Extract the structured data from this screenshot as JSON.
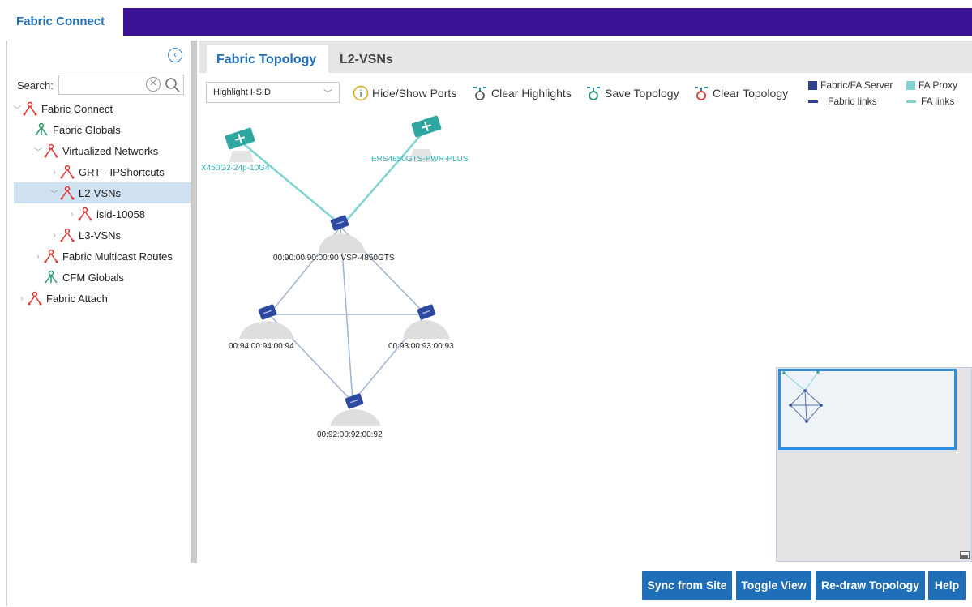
{
  "app": {
    "tab_title": "Fabric Connect"
  },
  "sidebar": {
    "search_label": "Search:",
    "search_placeholder": "",
    "tree": [
      {
        "label": "Fabric Connect",
        "icon": "network-red-icon",
        "expanded": true
      },
      {
        "label": "Fabric Globals",
        "icon": "network-green-icon"
      },
      {
        "label": "Virtualized Networks",
        "icon": "network-red-icon",
        "expanded": true
      },
      {
        "label": "GRT - IPShortcuts",
        "icon": "network-red-icon"
      },
      {
        "label": "L2-VSNs",
        "icon": "network-red-icon",
        "expanded": true,
        "selected": true
      },
      {
        "label": "isid-10058",
        "icon": "network-red-icon"
      },
      {
        "label": "L3-VSNs",
        "icon": "network-red-icon"
      },
      {
        "label": "Fabric Multicast Routes",
        "icon": "network-red-icon"
      },
      {
        "label": "CFM Globals",
        "icon": "network-green-icon"
      },
      {
        "label": "Fabric Attach",
        "icon": "network-red-icon"
      }
    ]
  },
  "tabs": [
    {
      "label": "Fabric Topology",
      "active": true
    },
    {
      "label": "L2-VSNs",
      "active": false
    }
  ],
  "toolbar": {
    "highlight_select": "Highlight I-SID",
    "hide_show_ports": "Hide/Show Ports",
    "clear_highlights": "Clear Highlights",
    "save_topology": "Save Topology",
    "clear_topology": "Clear Topology"
  },
  "legend": {
    "fabric_server": "Fabric/FA Server",
    "fa_proxy": "FA Proxy",
    "fabric_links": "Fabric links",
    "fa_links": "FA links",
    "colors": {
      "fabric": "#2e3f8f",
      "fa": "#7fd3d1"
    }
  },
  "topology": {
    "nodes": {
      "x450": "X450G2-24p-10G4",
      "ers": "ERS4850GTS-PWR-PLUS",
      "vsp": "00:90:00:90:00:90 VSP-4850GTS",
      "n94": "00:94:00:94:00:94",
      "n93": "00:93:00:93:00:93",
      "n92": "00:92:00:92:00:92"
    }
  },
  "buttons": {
    "sync": "Sync from Site",
    "toggle": "Toggle View",
    "redraw": "Re-draw Topology",
    "help": "Help"
  }
}
